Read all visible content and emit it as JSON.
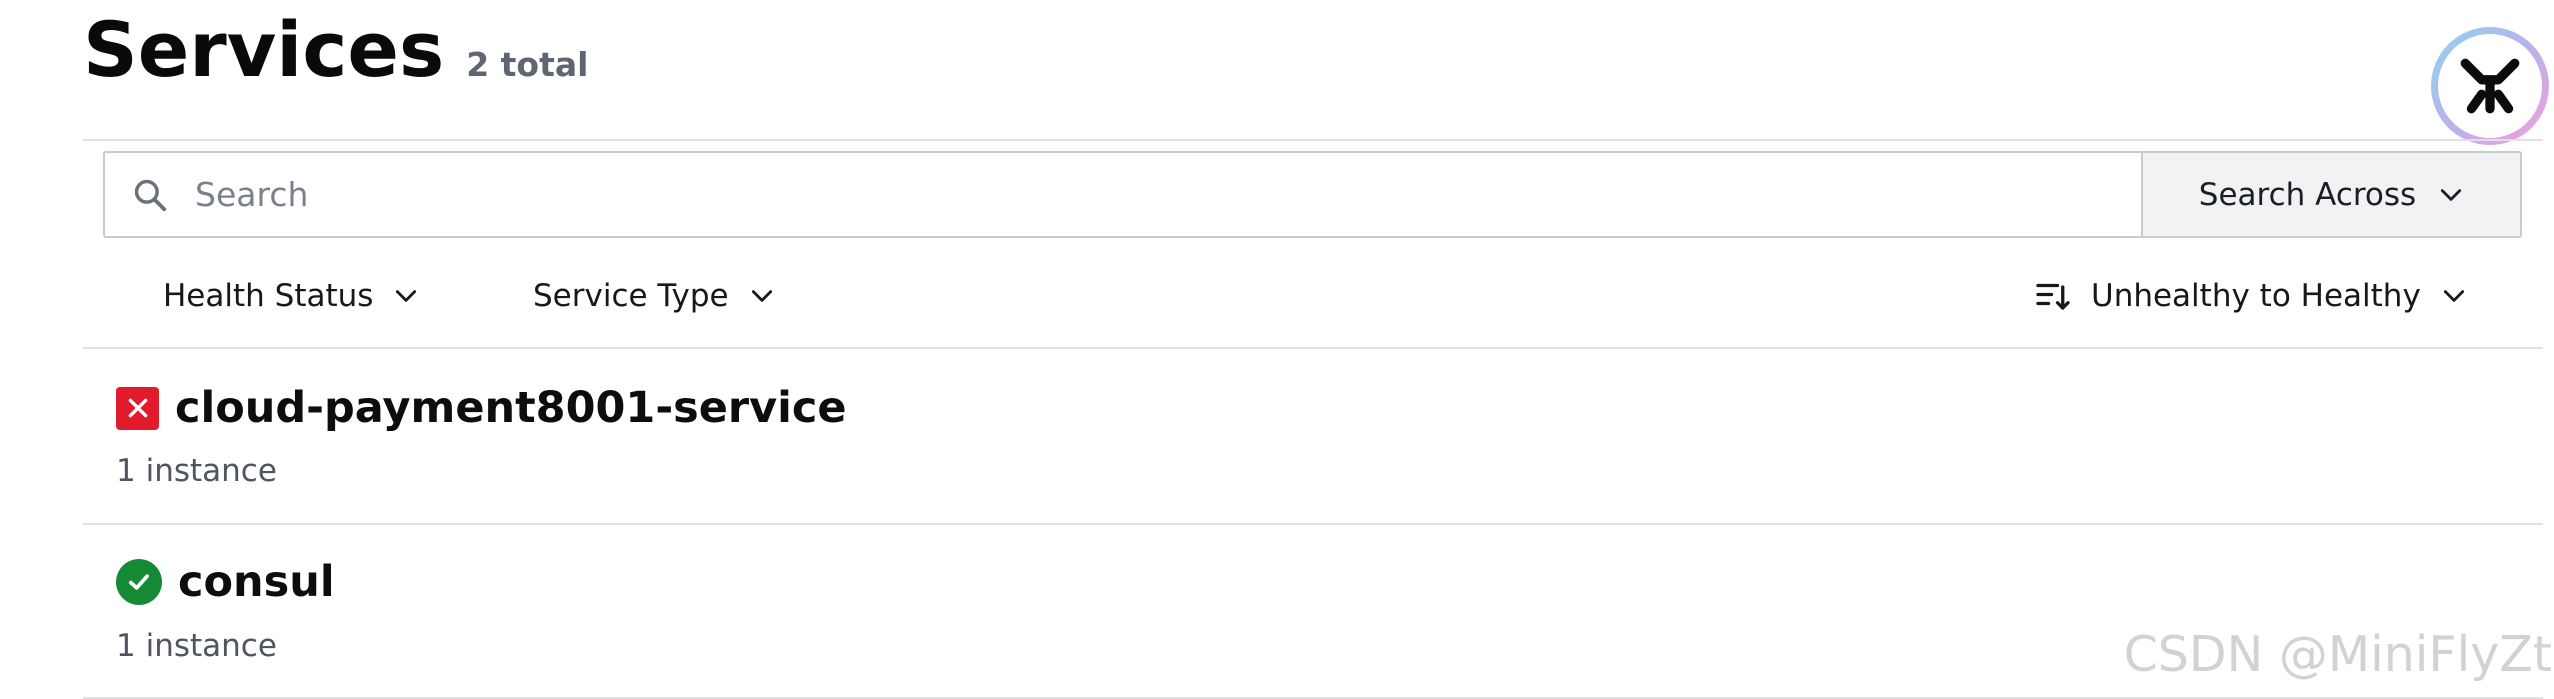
{
  "header": {
    "title": "Services",
    "count": "2 total"
  },
  "search": {
    "placeholder": "Search",
    "value": "",
    "scope_label": "Search Across"
  },
  "filters": {
    "health_status_label": "Health Status",
    "service_type_label": "Service Type",
    "sort_label": "Unhealthy to Healthy"
  },
  "services": [
    {
      "name": "cloud-payment8001-service",
      "instances": "1 instance",
      "status": "failing"
    },
    {
      "name": "consul",
      "instances": "1 instance",
      "status": "passing"
    }
  ],
  "colors": {
    "failing": "#e21b2c",
    "passing": "#158a35",
    "muted_text": "#4e5561"
  },
  "icons": {
    "search": "search-icon",
    "chevron": "chevron-down-icon",
    "sort": "sort-icon",
    "failing": "x-square-icon",
    "passing": "check-circle-icon",
    "logo": "logo-icon"
  },
  "watermark": "CSDN @MiniFlyZt"
}
